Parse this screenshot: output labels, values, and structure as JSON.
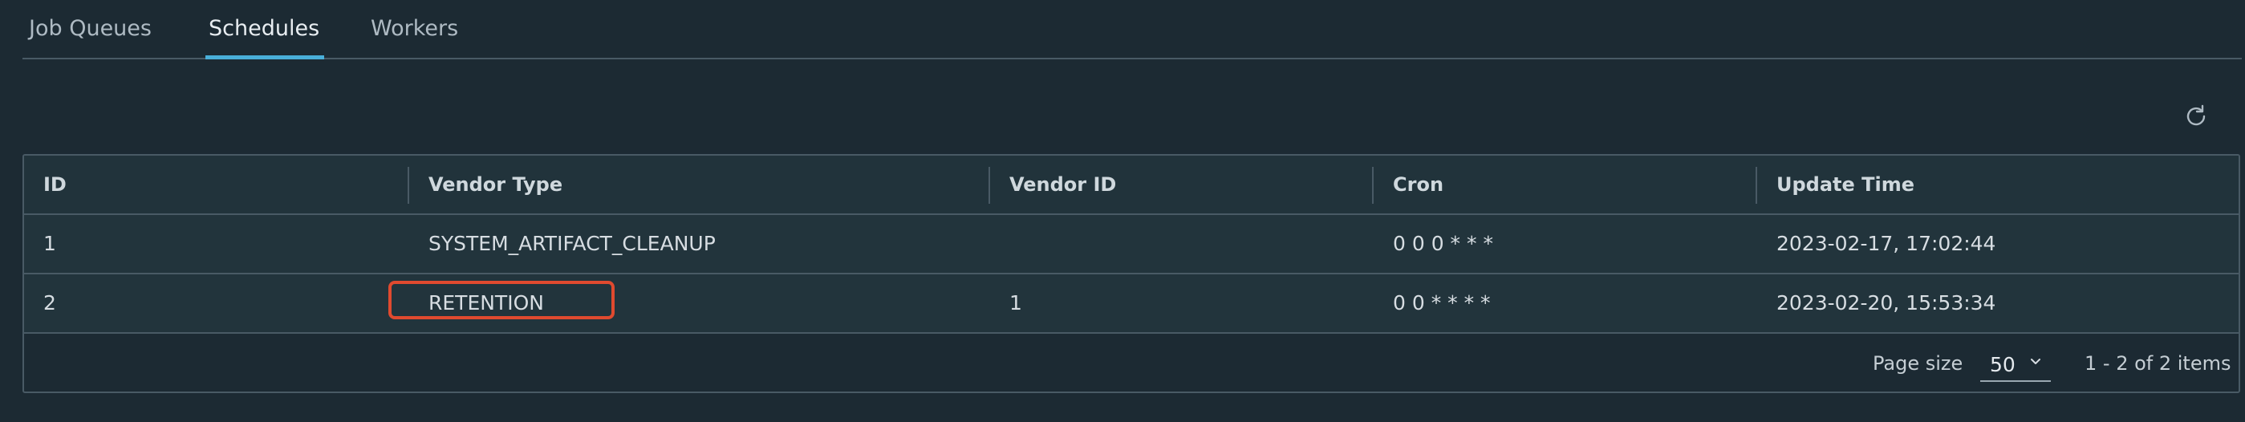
{
  "tabs": [
    {
      "label": "Job Queues",
      "active": false
    },
    {
      "label": "Schedules",
      "active": true
    },
    {
      "label": "Workers",
      "active": false
    }
  ],
  "toolbar": {
    "refresh_icon": "refresh-icon"
  },
  "table": {
    "columns": [
      "ID",
      "Vendor Type",
      "Vendor ID",
      "Cron",
      "Update Time"
    ],
    "rows": [
      [
        "1",
        "SYSTEM_ARTIFACT_CLEANUP",
        "",
        "0 0 0 * * *",
        "2023-02-17, 17:02:44"
      ],
      [
        "2",
        "RETENTION",
        "1",
        "0 0 * * * *",
        "2023-02-20, 15:53:34"
      ]
    ],
    "highlighted_cell": {
      "row": 2,
      "column": "Vendor Type",
      "color": "#e04a2f"
    }
  },
  "footer": {
    "page_size_label": "Page size",
    "page_size_value": "50",
    "pagination_info": "1 - 2 of 2 items"
  },
  "colors": {
    "background": "#1c2a33",
    "accent": "#49afd9",
    "border": "#495a65",
    "highlight": "#e04a2f"
  }
}
